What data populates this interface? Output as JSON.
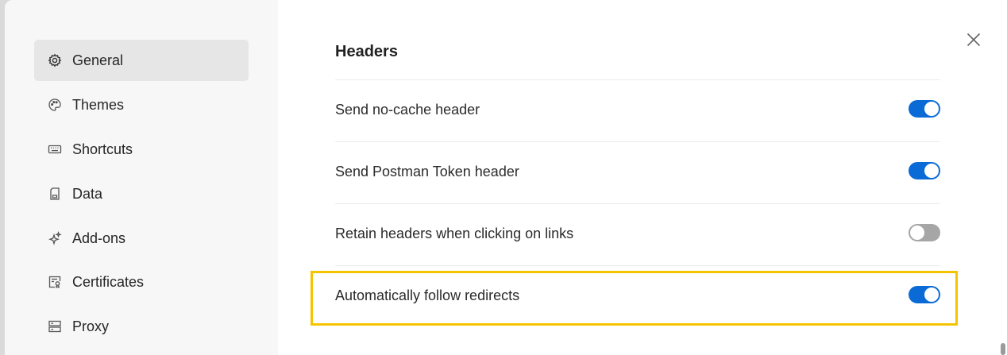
{
  "sidebar": {
    "items": [
      {
        "label": "General",
        "icon": "gear-icon",
        "active": true
      },
      {
        "label": "Themes",
        "icon": "palette-icon",
        "active": false
      },
      {
        "label": "Shortcuts",
        "icon": "keyboard-icon",
        "active": false
      },
      {
        "label": "Data",
        "icon": "sd-card-icon",
        "active": false
      },
      {
        "label": "Add-ons",
        "icon": "sparkle-icon",
        "active": false
      },
      {
        "label": "Certificates",
        "icon": "certificate-icon",
        "active": false
      },
      {
        "label": "Proxy",
        "icon": "server-icon",
        "active": false
      }
    ]
  },
  "main": {
    "section_title": "Headers",
    "close_icon": "close-icon",
    "settings": [
      {
        "label": "Send no-cache header",
        "enabled": true
      },
      {
        "label": "Send Postman Token header",
        "enabled": true
      },
      {
        "label": "Retain headers when clicking on links",
        "enabled": false
      },
      {
        "label": "Automatically follow redirects",
        "enabled": true
      }
    ]
  },
  "colors": {
    "toggle_on": "#0a6bd6",
    "toggle_off": "#a6a6a6",
    "highlight": "#f5c400"
  }
}
